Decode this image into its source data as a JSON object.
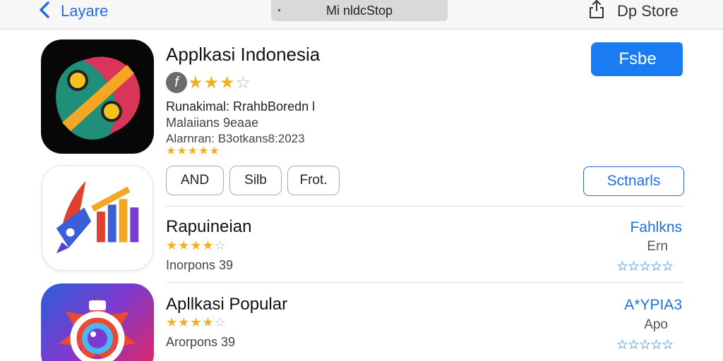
{
  "header": {
    "back_label": "Layare",
    "url_text": "Mi nldcStop",
    "store_label": "Dp Store"
  },
  "featured": {
    "title": "Applkasi Indonesia",
    "rating_badge": "f",
    "rating_stars": "★★★",
    "rating_empty": "☆",
    "meta_line1": "Runakimal: RrahbBoredn l",
    "meta_line2": "Malaiians 9eaae",
    "meta_line3": "Alarnran: B3otkans8:2023",
    "meta_stars": "★★★★★",
    "get_label": "Fsbe",
    "chips": [
      "AND",
      "Silb",
      "Frot."
    ],
    "secondary_label": "Sctnarls"
  },
  "list": [
    {
      "title": "Rapuineian",
      "stars": "★★★★",
      "stars_empty": "☆",
      "subtitle": "Inorpons 39",
      "right_link": "Fahlkns",
      "right_sub": "Ern",
      "right_stars": "☆☆☆☆☆"
    },
    {
      "title": "Apllkasi Popular",
      "stars": "★★★★",
      "stars_empty": "☆",
      "subtitle": "Arorpons 39",
      "right_link": "A*YPIA3",
      "right_sub": "Apo",
      "right_stars": "☆☆☆☆☆"
    }
  ],
  "colors": {
    "accent": "#1f6fe0",
    "button": "#1a7cf2",
    "star": "#f3b01c"
  }
}
